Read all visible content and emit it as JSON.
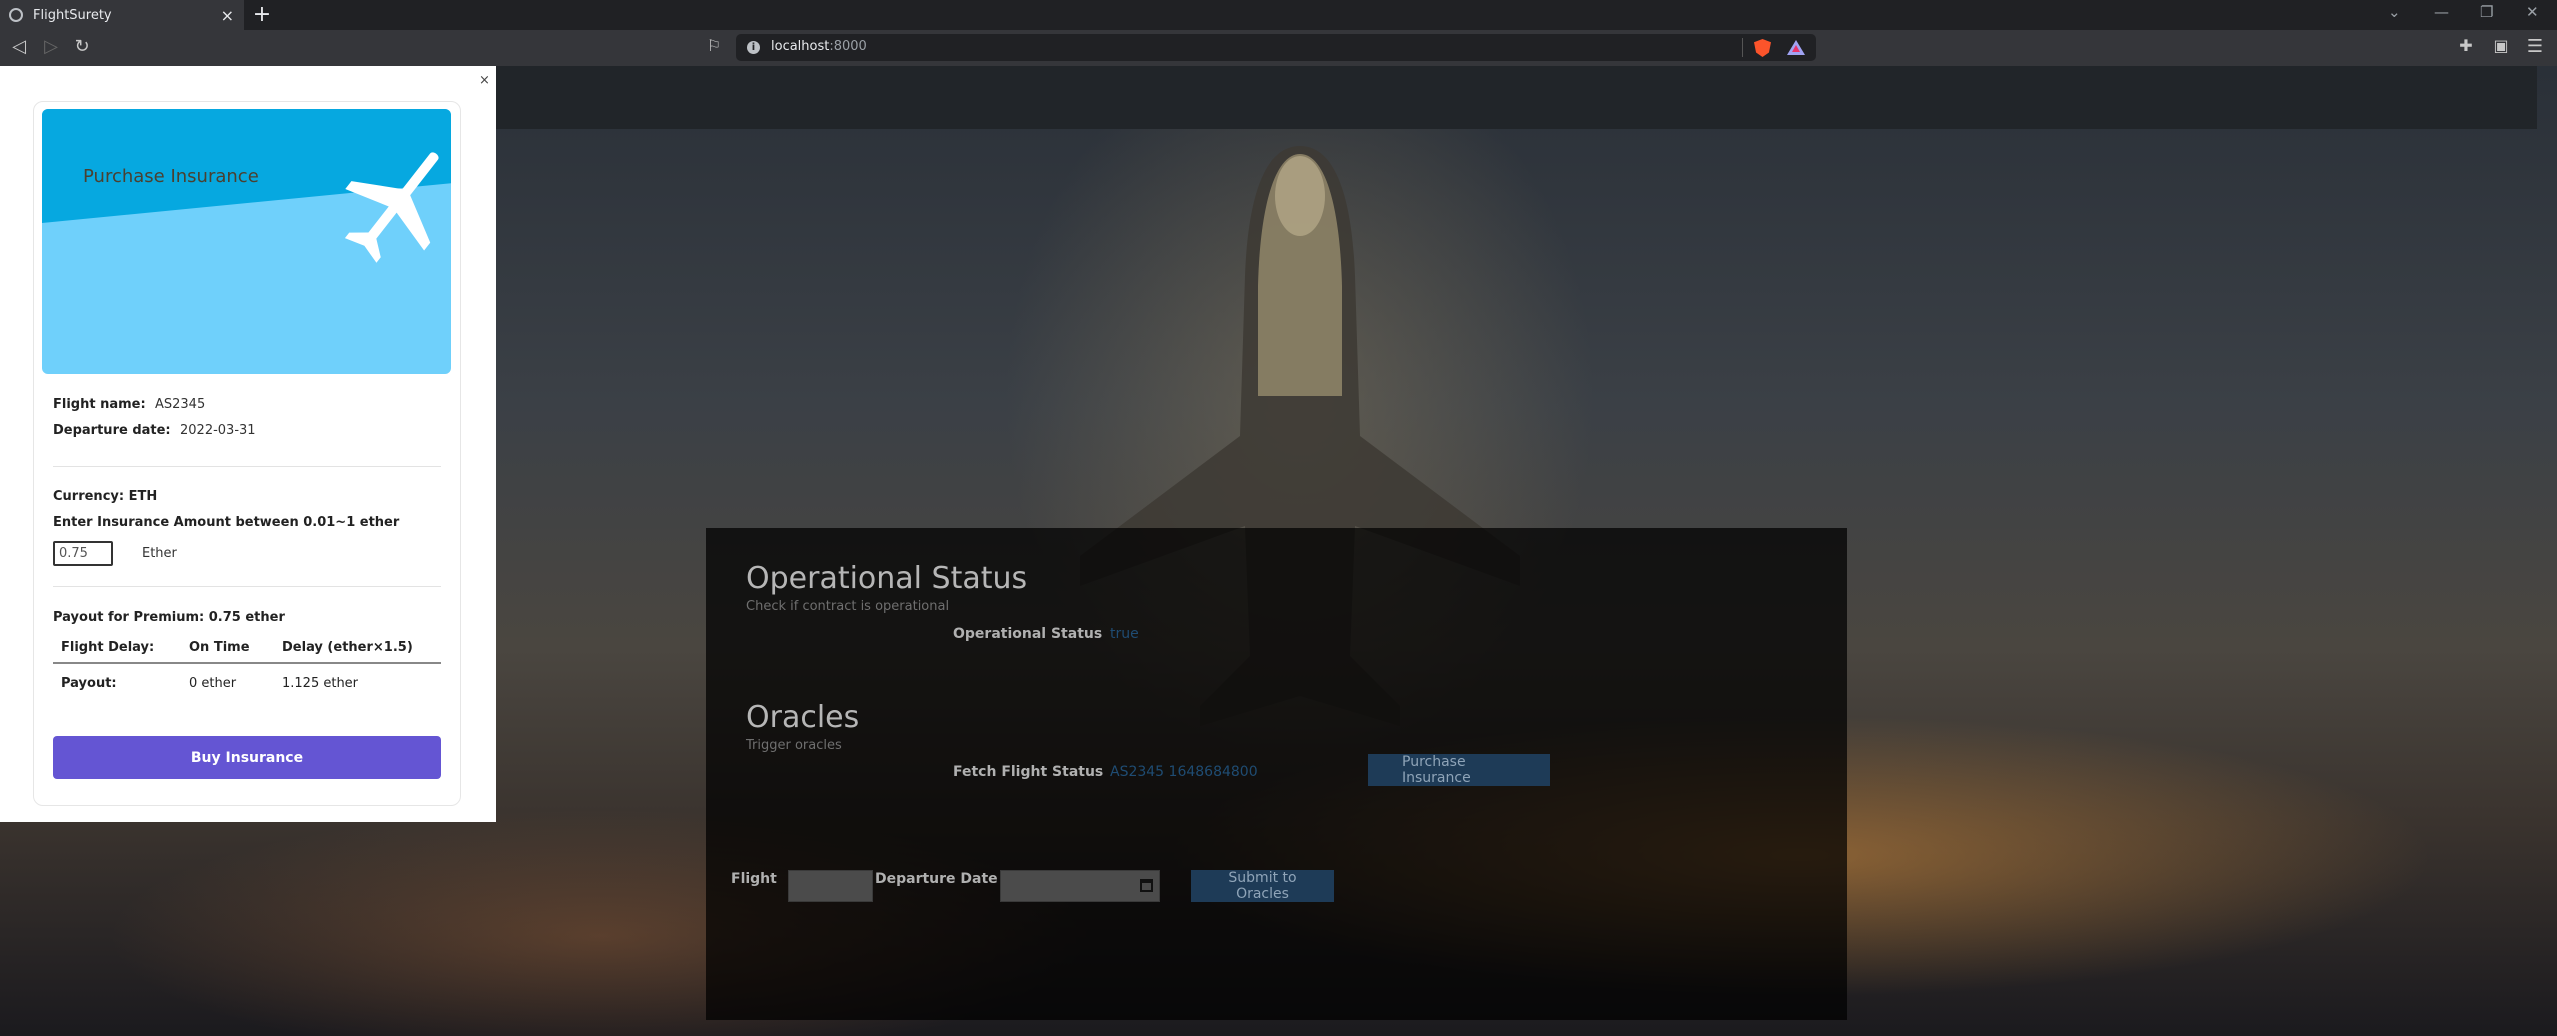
{
  "browser": {
    "tab_title": "FlightSurety",
    "tab_close": "×",
    "new_tab": "+",
    "url_host": "localhost",
    "url_port": ":8000"
  },
  "modal": {
    "close": "×",
    "hero_title": "Purchase Insurance",
    "flight_name_label": "Flight name:",
    "flight_name_value": "AS2345",
    "departure_label": "Departure date:",
    "departure_value": "2022-03-31",
    "currency": "Currency: ETH",
    "amount_prompt": "Enter Insurance Amount between 0.01~1 ether",
    "amount_value": "0.75",
    "amount_unit": "Ether",
    "payout_summary": "Payout for Premium: 0.75 ether",
    "table": {
      "headers": [
        "Flight Delay:",
        "On Time",
        "Delay (ether×1.5)"
      ],
      "row": [
        "Payout:",
        "0 ether",
        "1.125 ether"
      ]
    },
    "buy_button": "Buy Insurance"
  },
  "page": {
    "operational": {
      "title": "Operational Status",
      "subtitle": "Check if contract is operational",
      "label": "Operational Status",
      "value": "true"
    },
    "oracles": {
      "title": "Oracles",
      "subtitle": "Trigger oracles",
      "fetch_label": "Fetch Flight Status",
      "fetch_value": "AS2345 1648684800",
      "purchase_button": "Purchase Insurance"
    },
    "form": {
      "flight_label": "Flight",
      "departure_label": "Departure Date",
      "submit_button": "Submit to Oracles"
    }
  },
  "colors": {
    "buy_button": "#6455d3",
    "hero_light": "#6fd0fb",
    "hero_dark": "#06a8e0",
    "dark_button": "#1e3b57"
  }
}
